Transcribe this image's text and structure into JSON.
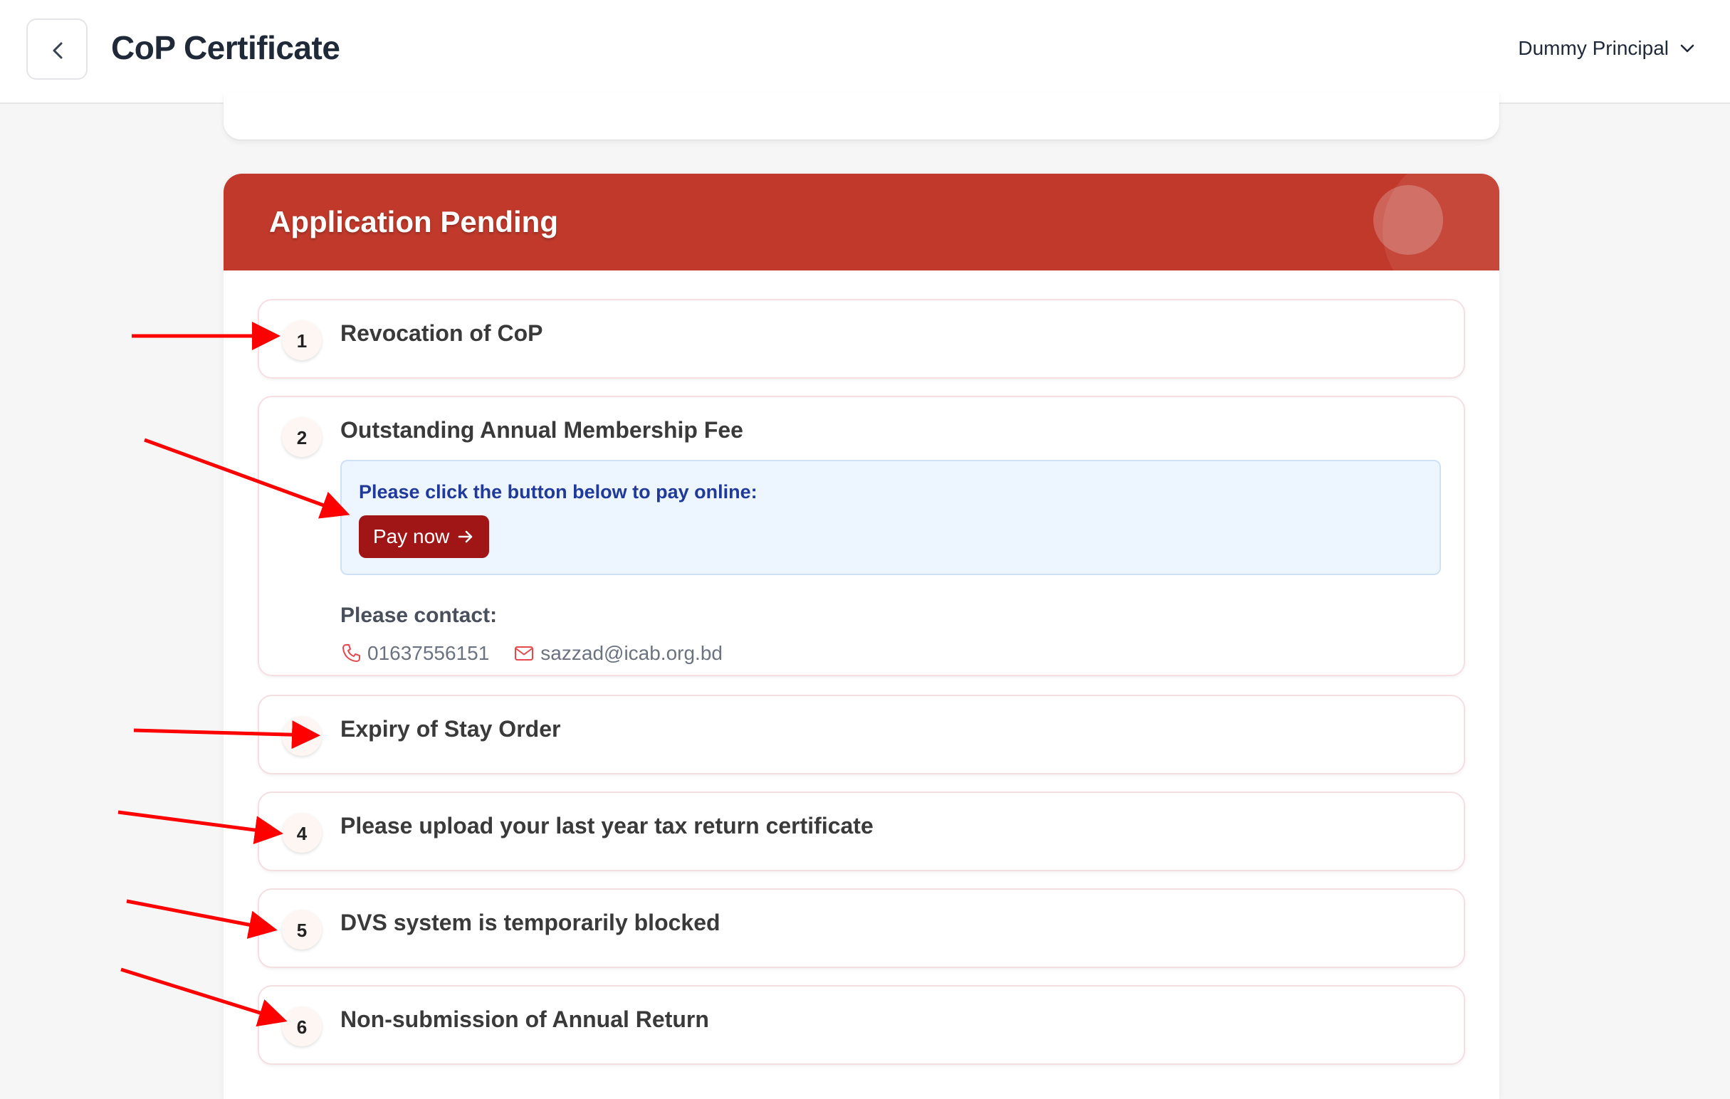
{
  "header": {
    "title": "CoP Certificate",
    "user_name": "Dummy Principal",
    "back_icon": "chevron-left-icon",
    "user_menu_icon": "chevron-down-icon"
  },
  "banner": {
    "title": "Application Pending",
    "color": "#c0392b"
  },
  "items": [
    {
      "number": "1",
      "title": "Revocation of CoP"
    },
    {
      "number": "2",
      "title": "Outstanding Annual Membership Fee",
      "pay_instruction": "Please click the button below to pay online:",
      "pay_button": "Pay now",
      "contact_label": "Please contact:",
      "phone": "01637556151",
      "email": "sazzad@icab.org.bd"
    },
    {
      "number": "3",
      "title": "Expiry of Stay Order"
    },
    {
      "number": "4",
      "title": "Please upload your last year tax return certificate"
    },
    {
      "number": "5",
      "title": "DVS system is temporarily blocked"
    },
    {
      "number": "6",
      "title": "Non-submission of Annual Return"
    }
  ],
  "colors": {
    "accent_red": "#c0392b",
    "pay_button": "#a01515",
    "annotation_arrow": "#ff0000",
    "info_text": "#1f3a9b"
  }
}
